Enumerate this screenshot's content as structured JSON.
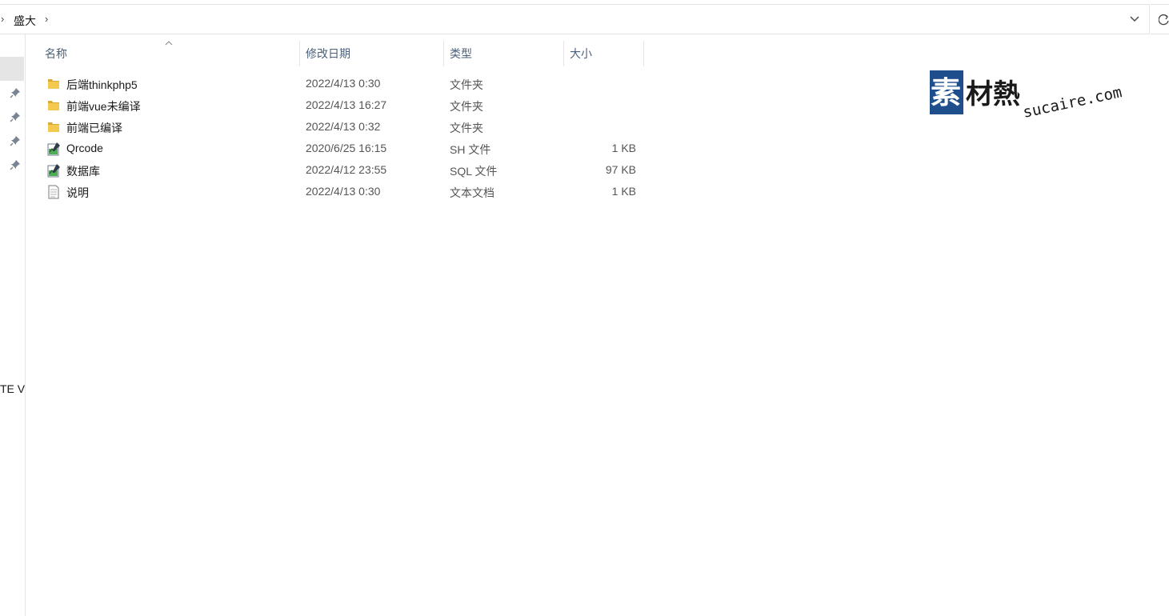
{
  "address_bar": {
    "breadcrumb": "盛大",
    "leading_chevron": "›",
    "trailing_chevron": "›"
  },
  "nav_pane": {
    "fragment_text": "TE V"
  },
  "columns": {
    "name": "名称",
    "date": "修改日期",
    "type": "类型",
    "size": "大小"
  },
  "files": [
    {
      "name": "后端thinkphp5",
      "date": "2022/4/13 0:30",
      "type": "文件夹",
      "size": "",
      "icon": "folder-icon"
    },
    {
      "name": "前端vue未编译",
      "date": "2022/4/13 16:27",
      "type": "文件夹",
      "size": "",
      "icon": "folder-icon"
    },
    {
      "name": "前端已编译",
      "date": "2022/4/13 0:32",
      "type": "文件夹",
      "size": "",
      "icon": "folder-icon"
    },
    {
      "name": "Qrcode",
      "date": "2020/6/25 16:15",
      "type": "SH 文件",
      "size": "1 KB",
      "icon": "script-file-icon"
    },
    {
      "name": "数据库",
      "date": "2022/4/12 23:55",
      "type": "SQL 文件",
      "size": "97 KB",
      "icon": "script-file-icon"
    },
    {
      "name": "说明",
      "date": "2022/4/13 0:30",
      "type": "文本文档",
      "size": "1 KB",
      "icon": "text-file-icon"
    }
  ],
  "watermark": {
    "chinese": "素材熱",
    "latin": "sucaire.com"
  },
  "colors": {
    "header_text": "#4c607a",
    "folder": "#f3c94f",
    "selection": "#e5e5e5",
    "watermark_blue": "#1f4e8c"
  }
}
